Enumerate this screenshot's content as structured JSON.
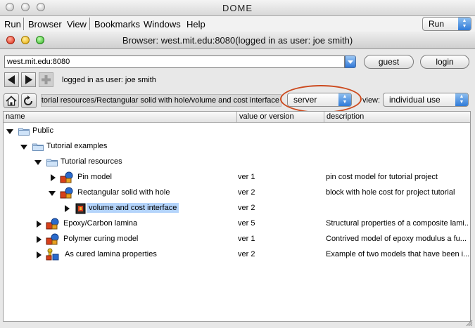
{
  "app": {
    "title": "DOME",
    "menu": [
      "Run",
      "Browser",
      "View",
      "Bookmarks",
      "Windows",
      "Help"
    ],
    "run_select": "Run"
  },
  "browser": {
    "window_title": "Browser: west.mit.edu:8080(logged in as user: joe smith)",
    "url": "west.mit.edu:8080",
    "guest_label": "guest",
    "login_label": "login",
    "status": "logged in as user: joe smith",
    "path": "tutorial resources/Rectangular solid with hole/volume and cost interface",
    "location_select": "server",
    "view_label": "view:",
    "view_select": "individual use"
  },
  "table": {
    "columns": [
      "name",
      "value or version",
      "description"
    ],
    "rows": [
      {
        "name": "Public",
        "version": "",
        "description": ""
      },
      {
        "name": "Tutorial examples",
        "version": "",
        "description": ""
      },
      {
        "name": "Tutorial resources",
        "version": "",
        "description": ""
      },
      {
        "name": "Pin  model",
        "version": "ver 1",
        "description": "pin cost model for tutorial project"
      },
      {
        "name": "Rectangular solid with hole",
        "version": "ver 2",
        "description": "block with hole cost for project tutorial"
      },
      {
        "name": "volume and cost interface",
        "version": "ver 2",
        "description": ""
      },
      {
        "name": "Epoxy/Carbon lamina",
        "version": "ver 5",
        "description": "Structural properties of a composite lami..."
      },
      {
        "name": "Polymer curing model",
        "version": "ver 1",
        "description": "Contrived model  of epoxy modulus a fu..."
      },
      {
        "name": "As cured lamina properties",
        "version": "ver 2",
        "description": "Example of two models that have been i..."
      }
    ]
  }
}
